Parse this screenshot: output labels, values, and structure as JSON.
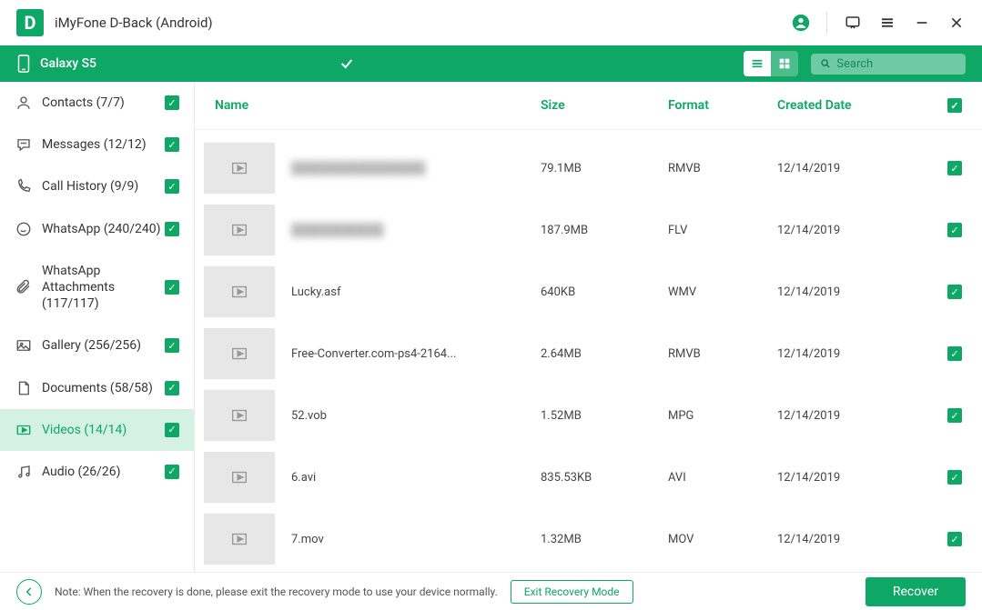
{
  "titlebar": {
    "app_title": "iMyFone D-Back (Android)",
    "logo_letter": "D"
  },
  "devicebar": {
    "device_name": "Galaxy S5"
  },
  "search": {
    "placeholder": "Search"
  },
  "sidebar": {
    "items": [
      {
        "label": "Contacts (7/7)",
        "icon": "contact"
      },
      {
        "label": "Messages (12/12)",
        "icon": "message"
      },
      {
        "label": "Call History (9/9)",
        "icon": "phone"
      },
      {
        "label": "WhatsApp (240/240)",
        "icon": "whatsapp"
      },
      {
        "label": "WhatsApp Attachments (117/117)",
        "icon": "attach"
      },
      {
        "label": "Gallery (256/256)",
        "icon": "image"
      },
      {
        "label": "Documents (58/58)",
        "icon": "doc"
      },
      {
        "label": "Videos (14/14)",
        "icon": "video",
        "active": true
      },
      {
        "label": "Audio (26/26)",
        "icon": "audio"
      }
    ]
  },
  "columns": {
    "name": "Name",
    "size": "Size",
    "format": "Format",
    "date": "Created Date"
  },
  "rows": [
    {
      "name": "████████████████",
      "size": "79.1MB",
      "format": "RMVB",
      "date": "12/14/2019",
      "blur": true
    },
    {
      "name": "███████████",
      "size": "187.9MB",
      "format": "FLV",
      "date": "12/14/2019",
      "blur": true
    },
    {
      "name": "Lucky.asf",
      "size": "640KB",
      "format": "WMV",
      "date": "12/14/2019"
    },
    {
      "name": "Free-Converter.com-ps4-2164...",
      "size": "2.64MB",
      "format": "RMVB",
      "date": "12/14/2019"
    },
    {
      "name": "52.vob",
      "size": "1.52MB",
      "format": "MPG",
      "date": "12/14/2019"
    },
    {
      "name": "6.avi",
      "size": "835.53KB",
      "format": "AVI",
      "date": "12/14/2019"
    },
    {
      "name": "7.mov",
      "size": "1.32MB",
      "format": "MOV",
      "date": "12/14/2019"
    }
  ],
  "footer": {
    "note": "Note: When the recovery is done, please exit the recovery mode to use your device normally.",
    "exit_label": "Exit Recovery Mode",
    "recover_label": "Recover"
  },
  "colors": {
    "brand": "#0ea765"
  }
}
